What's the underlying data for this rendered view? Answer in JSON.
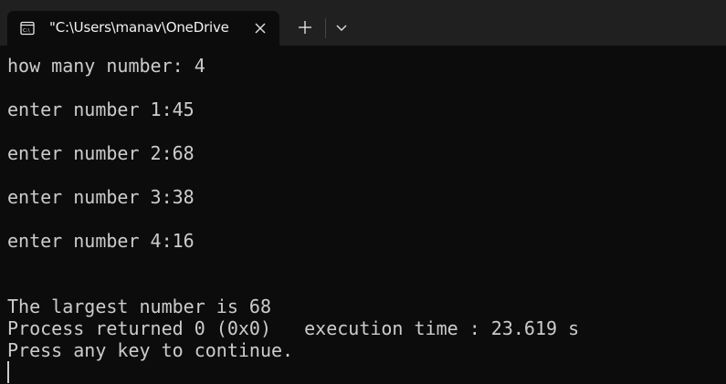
{
  "tab": {
    "title": "\"C:\\Users\\manav\\OneDrive",
    "icon": "terminal-cmd-icon"
  },
  "toolbar": {
    "new_tab_icon": "plus-icon",
    "dropdown_icon": "chevron-down-icon",
    "close_icon": "close-icon"
  },
  "terminal": {
    "lines": [
      "how many number: 4",
      "enter number 1:45",
      "enter number 2:68",
      "enter number 3:38",
      "enter number 4:16",
      "The largest number is 68",
      "Process returned 0 (0x0)   execution time : 23.619 s",
      "Press any key to continue."
    ]
  },
  "colors": {
    "background": "#0c0c0c",
    "titlebar": "#202020",
    "text": "#cccccc"
  }
}
